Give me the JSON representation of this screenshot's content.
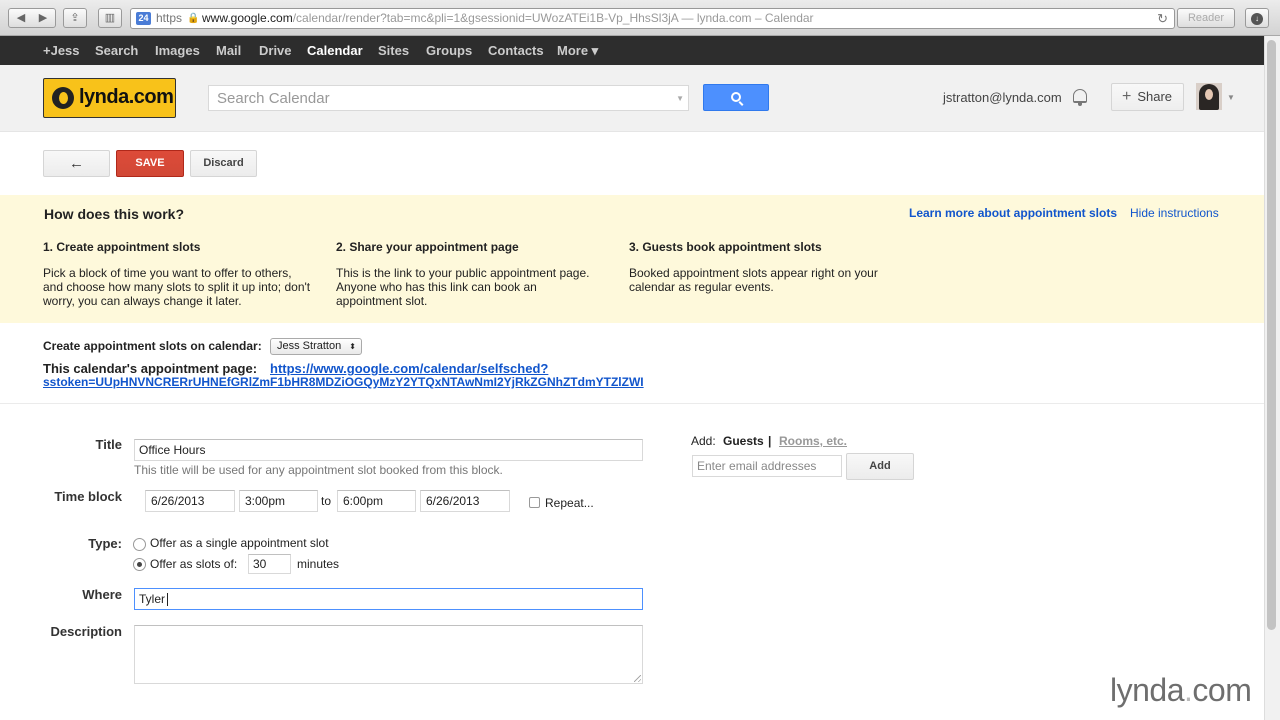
{
  "browser": {
    "url_scheme": "https",
    "url_host": "www.google.com",
    "url_path": "/calendar/render?tab=mc&pli=1&gsessionid=UWozATEi1B-Vp_HhsSl3jA",
    "url_title": " — lynda.com – Calendar",
    "favicon_text": "24",
    "reader_label": "Reader"
  },
  "gbar": {
    "items": [
      "+Jess",
      "Search",
      "Images",
      "Mail",
      "Drive",
      "Calendar",
      "Sites",
      "Groups",
      "Contacts",
      "More ▾"
    ],
    "active": "Calendar"
  },
  "header": {
    "logo_text": "lynda.com",
    "search_placeholder": "Search Calendar",
    "user_email": "jstratton@lynda.com",
    "share_label": "Share"
  },
  "toolbar": {
    "back_label": "←",
    "save_label": "SAVE",
    "discard_label": "Discard"
  },
  "instructions": {
    "title": "How does this work?",
    "learn_more": "Learn more about appointment slots",
    "hide": "Hide instructions",
    "steps": [
      {
        "heading": "1. Create appointment slots",
        "text": "Pick a block of time you want to offer to others, and choose how many slots to split it up into; don't worry, you can always change it later."
      },
      {
        "heading": "2. Share your appointment page",
        "text": "This is the link to your public appointment page. Anyone who has this link can book an appointment slot."
      },
      {
        "heading": "3. Guests book appointment slots",
        "text": "Booked appointment slots appear right on your calendar as regular events."
      }
    ]
  },
  "calendar": {
    "create_label": "Create appointment slots on calendar:",
    "selected_calendar": "Jess Stratton",
    "page_label": "This calendar's appointment page:",
    "page_link_line1": "https://www.google.com/calendar/selfsched?",
    "page_link_line2": "sstoken=UUpHNVNCRERrUHNEfGRlZmF1bHR8MDZiOGQyMzY2YTQxNTAwNmI2YjRkZGNhZTdmYTZlZWI"
  },
  "form": {
    "title_label": "Title",
    "title_value": "Office Hours",
    "title_hint": "This title will be used for any appointment slot booked from this block.",
    "time_label": "Time block",
    "start_date": "6/26/2013",
    "start_time": "3:00pm",
    "to_label": "to",
    "end_time": "6:00pm",
    "end_date": "6/26/2013",
    "repeat_label": "Repeat...",
    "type_label": "Type:",
    "type_single": "Offer as a single appointment slot",
    "type_slots": "Offer as slots of:",
    "slot_minutes": "30",
    "minutes_label": "minutes",
    "where_label": "Where",
    "where_value": "Tyler",
    "description_label": "Description"
  },
  "guests": {
    "add_label": "Add:",
    "guests_tab": "Guests",
    "separator": "|",
    "rooms_tab": "Rooms, etc.",
    "email_placeholder": "Enter email addresses",
    "add_button": "Add"
  },
  "watermark": {
    "brand": "lynda",
    "dot": ".",
    "suffix": "com"
  }
}
